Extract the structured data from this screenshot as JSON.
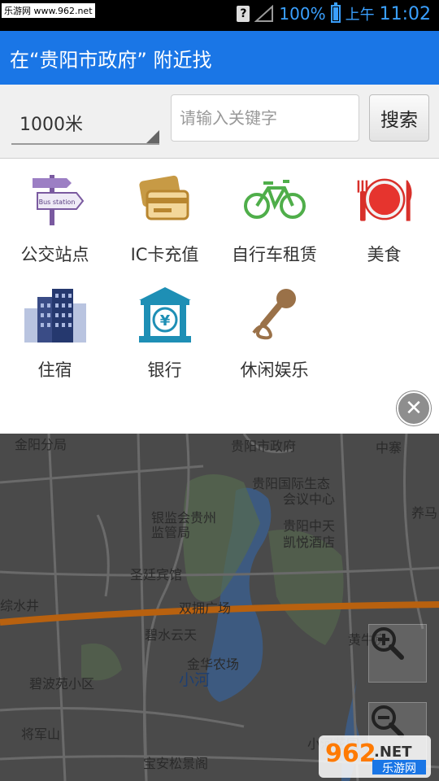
{
  "status_bar": {
    "site_label": "乐游网 www.962.net",
    "unknown_icon": "?",
    "battery_percent": "100%",
    "am_pm": "上午",
    "time": "11:02"
  },
  "app_bar": {
    "title": "在“贵阳市政府” 附近找"
  },
  "search": {
    "distance_value": "1000米",
    "keyword_placeholder": "请输入关键字",
    "search_button_label": "搜索"
  },
  "categories": [
    {
      "label": "公交站点",
      "icon": "bus-station-sign-icon",
      "sign_text": "Bus station"
    },
    {
      "label": "IC卡充值",
      "icon": "ic-card-icon"
    },
    {
      "label": "自行车租赁",
      "icon": "bicycle-icon"
    },
    {
      "label": "美食",
      "icon": "fork-plate-knife-icon"
    },
    {
      "label": "住宿",
      "icon": "hotel-buildings-icon"
    },
    {
      "label": "银行",
      "icon": "bank-icon",
      "bank_symbol": "¥"
    },
    {
      "label": "休闲娱乐",
      "icon": "microphone-icon"
    }
  ],
  "close_symbol": "✕",
  "map": {
    "labels": [
      "金阳分局",
      "贵阳市政府",
      "中寨",
      "贵阳国际生态",
      "会议中心",
      "银监会贵州",
      "监管局",
      "贵阳中天",
      "凯悦酒店",
      "养马",
      "圣廷宾馆",
      "综水井",
      "双拥广场",
      "碧水云天",
      "黄牛房",
      "金华农场",
      "碧波苑小区",
      "将军山",
      "小河花园",
      "宝安松景阁"
    ],
    "water_label": "小河",
    "zoom_in_symbol": "+",
    "zoom_out_symbol": "−"
  },
  "watermark": {
    "number": "962",
    "net": ".NET",
    "site": "乐游网"
  },
  "colors": {
    "app_bar": "#1a76e6",
    "status_text": "#3aa0ff",
    "map_bg": "#4a4a4a",
    "road": "#b8610f"
  }
}
